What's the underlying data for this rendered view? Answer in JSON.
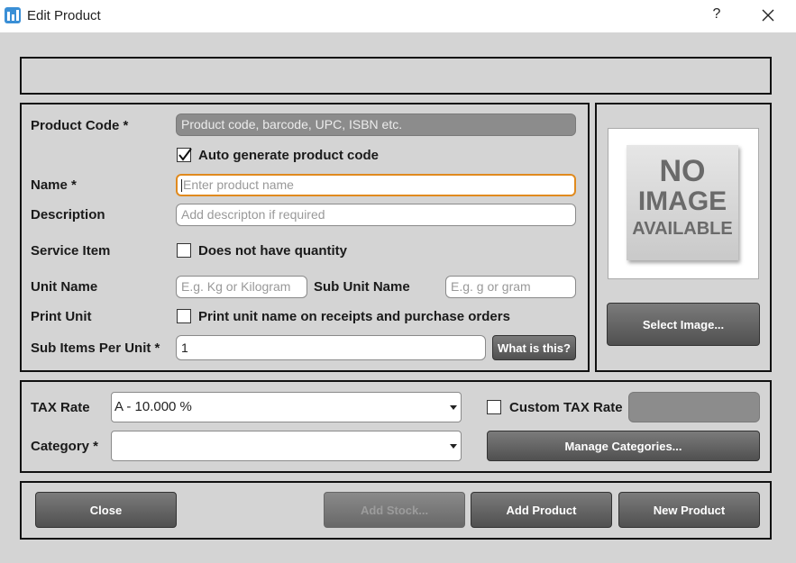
{
  "window": {
    "title": "Edit Product",
    "help_label": "?"
  },
  "form": {
    "product_code_label": "Product Code *",
    "product_code_placeholder": "Product code, barcode, UPC, ISBN etc.",
    "auto_generate_label": "Auto generate product code",
    "auto_generate_checked": true,
    "name_label": "Name *",
    "name_placeholder": "Enter product name",
    "description_label": "Description",
    "description_placeholder": "Add descripton if required",
    "service_item_label": "Service Item",
    "service_item_checkbox_label": "Does not have quantity",
    "unit_name_label": "Unit Name",
    "unit_name_placeholder": "E.g. Kg or Kilogram",
    "sub_unit_name_label": "Sub Unit Name",
    "sub_unit_name_placeholder": "E.g. g or gram",
    "print_unit_label": "Print Unit",
    "print_unit_checkbox_label": "Print unit name on receipts and purchase orders",
    "sub_items_label": "Sub Items Per Unit *",
    "sub_items_value": "1",
    "what_is_this_label": "What is this?"
  },
  "image": {
    "placeholder_lines": [
      "NO",
      "IMAGE",
      "AVAILABLE"
    ],
    "select_label": "Select Image..."
  },
  "tax": {
    "tax_rate_label": "TAX Rate",
    "tax_rate_value": "A - 10.000 %",
    "custom_tax_label": "Custom TAX Rate",
    "category_label": "Category *",
    "category_value": "",
    "manage_categories_label": "Manage Categories..."
  },
  "footer": {
    "close_label": "Close",
    "add_stock_label": "Add Stock...",
    "add_product_label": "Add Product",
    "new_product_label": "New Product"
  },
  "colors": {
    "accent_focus": "#e08a1e",
    "button_dark": "#5a5a5a",
    "window_bg": "#d4d4d4"
  }
}
